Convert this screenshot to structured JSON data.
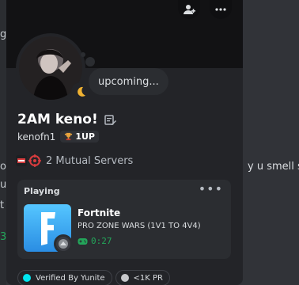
{
  "header": {
    "add_friend_icon": "person-add-icon",
    "more_icon": "more-dots-icon"
  },
  "profile": {
    "custom_status": "upcoming...",
    "display_name": "2AM keno!",
    "username": "kenofn1",
    "tag": "1UP",
    "status": "idle"
  },
  "mutual": {
    "label": "2 Mutual Servers"
  },
  "activity": {
    "heading": "Playing",
    "more": "•••",
    "game_title": "Fortnite",
    "details": "PRO ZONE WARS (1V1 TO 4V4)",
    "timer": "0:27"
  },
  "connections": [
    {
      "label": "Verified By Yunite",
      "color": "#00e6f0"
    },
    {
      "label": "<1K PR",
      "color": "#c8c9cc"
    }
  ],
  "background": {
    "right_snippet": "y u smell s",
    "frag_1": "g",
    "frag_2": "o",
    "frag_3": "u",
    "frag_4": "t",
    "frag_5": "3"
  },
  "colors": {
    "card_bg": "#232428",
    "banner_bg": "#121214",
    "accent_green": "#23a55a",
    "idle_moon": "#f0b232"
  }
}
